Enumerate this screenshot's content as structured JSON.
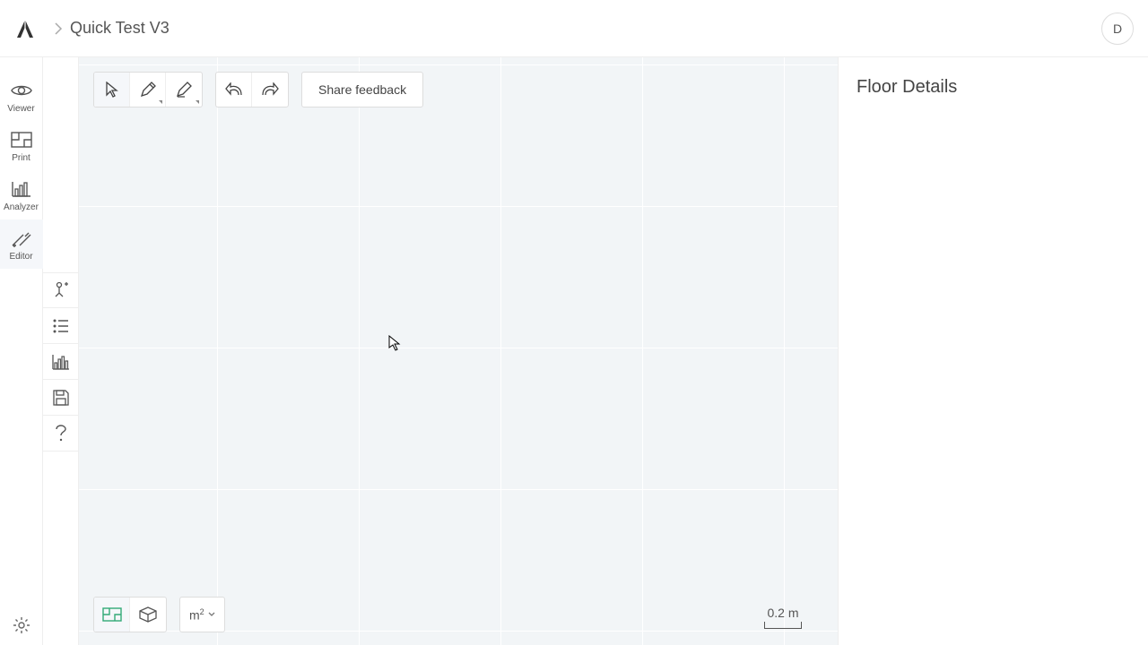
{
  "header": {
    "breadcrumb_title": "Quick Test V3",
    "avatar_initial": "D"
  },
  "mode_rail": {
    "items": [
      {
        "label": "Viewer"
      },
      {
        "label": "Print"
      },
      {
        "label": "Analyzer"
      },
      {
        "label": "Editor"
      }
    ],
    "active_index": 3
  },
  "top_toolbar": {
    "feedback_label": "Share feedback"
  },
  "bottom_toolbar": {
    "units_label": "m",
    "units_exp": "2"
  },
  "scale": {
    "label": "0.2 m"
  },
  "details": {
    "title": "Floor Details"
  }
}
